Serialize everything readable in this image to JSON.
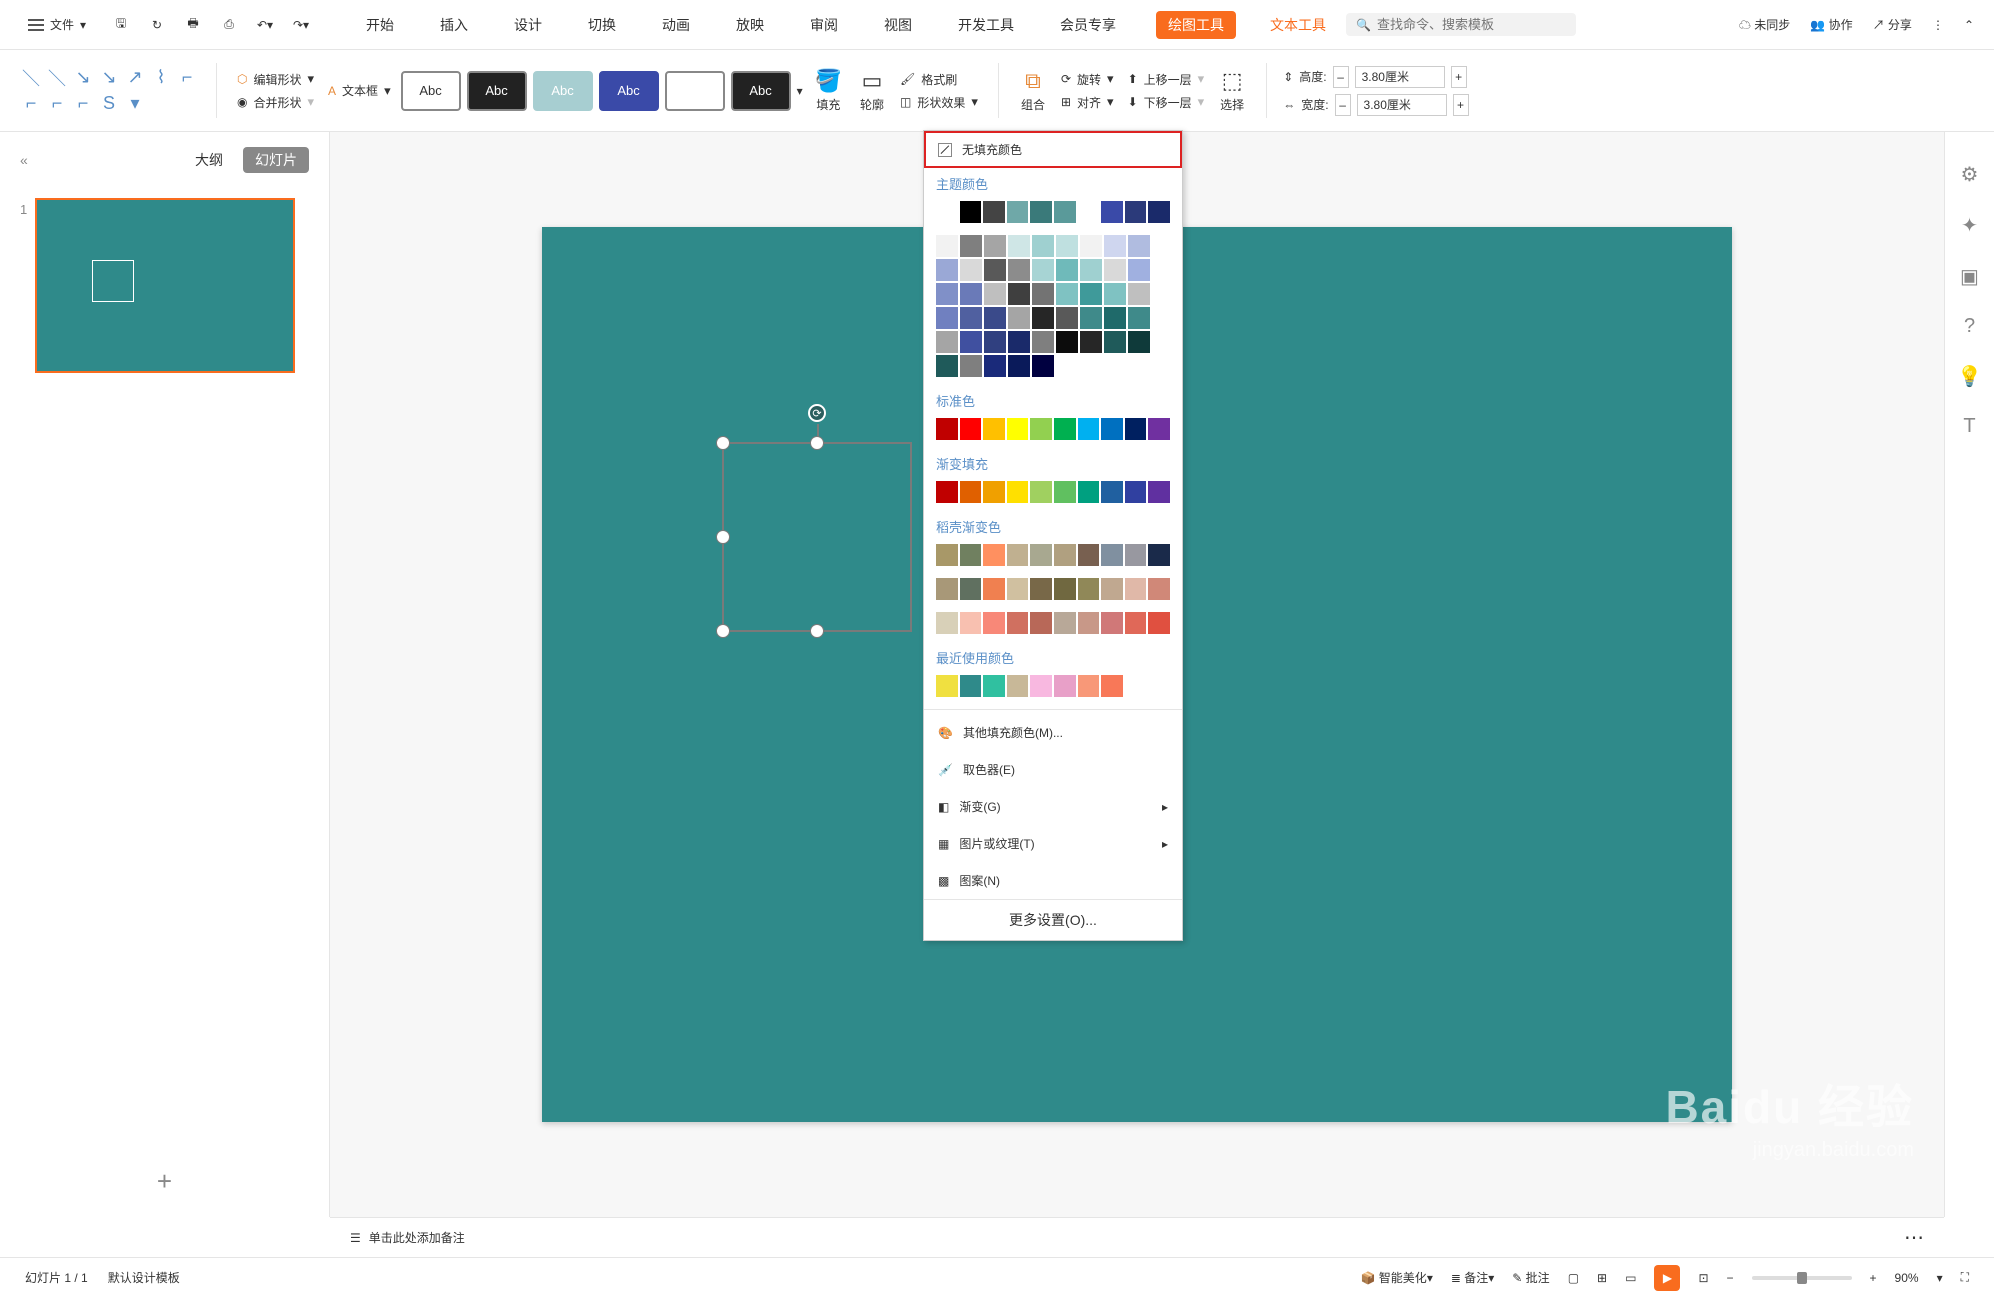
{
  "topbar": {
    "file": "文件",
    "sync": "未同步",
    "collab": "协作",
    "share": "分享"
  },
  "tabs": {
    "start": "开始",
    "insert": "插入",
    "design": "设计",
    "transition": "切换",
    "animation": "动画",
    "slideshow": "放映",
    "review": "审阅",
    "view": "视图",
    "dev": "开发工具",
    "member": "会员专享",
    "draw": "绘图工具",
    "text": "文本工具"
  },
  "search": {
    "placeholder": "查找命令、搜索模板"
  },
  "ribbon": {
    "editShape": "编辑形状",
    "mergeShape": "合并形状",
    "textbox": "文本框",
    "styleLabel": "Abc",
    "fill": "填充",
    "outline": "轮廓",
    "effects": "形状效果",
    "formatPainter": "格式刷",
    "group": "组合",
    "rotate": "旋转",
    "align": "对齐",
    "forward": "上移一层",
    "backward": "下移一层",
    "select": "选择",
    "height": "高度:",
    "width": "宽度:",
    "h_val": "3.80厘米",
    "w_val": "3.80厘米",
    "minus": "–",
    "plus": "+"
  },
  "slidepanel": {
    "outline": "大纲",
    "slides": "幻灯片",
    "num": "1"
  },
  "dropdown": {
    "noFill": "无填充颜色",
    "themeColors": "主题颜色",
    "standard": "标准色",
    "gradient": "渐变填充",
    "dokeGradient": "稻壳渐变色",
    "recent": "最近使用颜色",
    "otherFill": "其他填充颜色(M)...",
    "eyedropper": "取色器(E)",
    "grad": "渐变(G)",
    "pictex": "图片或纹理(T)",
    "pattern": "图案(N)",
    "more": "更多设置(O)...",
    "theme_row1": [
      "#ffffff",
      "#000000",
      "#444444",
      "#6fa8a8",
      "#3a7a7a",
      "#5a9a9a",
      "#ffffff",
      "#3a4aa8",
      "#2b3a7a",
      "#1a2a6a"
    ],
    "theme_matrix": [
      [
        "#f2f2f2",
        "#7f7f7f",
        "#a5a5a5",
        "#cfe6e6",
        "#9fd0d0",
        "#bfe0e0",
        "#f2f2f2",
        "#cfd6ef",
        "#b0bce0",
        "#9aa8d6"
      ],
      [
        "#d9d9d9",
        "#595959",
        "#8c8c8c",
        "#a7d4d4",
        "#6fbaba",
        "#9fd0d0",
        "#d9d9d9",
        "#a0b0e0",
        "#8090c8",
        "#6a7ab8"
      ],
      [
        "#bfbfbf",
        "#3f3f3f",
        "#737373",
        "#7fc2c2",
        "#3f9a9a",
        "#7fc2c2",
        "#bfbfbf",
        "#7080c0",
        "#5060a0",
        "#3a4a8a"
      ],
      [
        "#a5a5a5",
        "#262626",
        "#595959",
        "#3f8a8a",
        "#1f6a6a",
        "#3f8a8a",
        "#a5a5a5",
        "#4050a0",
        "#304080",
        "#1a2a6a"
      ],
      [
        "#7f7f7f",
        "#0c0c0c",
        "#262626",
        "#1f5a5a",
        "#0f3a3a",
        "#1f5a5a",
        "#7f7f7f",
        "#1a2a7a",
        "#0a1a5a",
        "#000040"
      ]
    ],
    "standard_colors": [
      "#c00000",
      "#ff0000",
      "#ffc000",
      "#ffff00",
      "#92d050",
      "#00b050",
      "#00b0f0",
      "#0070c0",
      "#002060",
      "#7030a0"
    ],
    "gradient_colors": [
      "#c00000",
      "#e06000",
      "#f0a000",
      "#ffe000",
      "#a0d060",
      "#60c060",
      "#00a080",
      "#2060a0",
      "#3040a0",
      "#6030a0"
    ],
    "doke1": [
      "#a89868",
      "#708060",
      "#ff9060",
      "#c0b090",
      "#a8a890",
      "#b0a080",
      "#786050",
      "#8090a0",
      "#9898a0",
      "#1a2a4a"
    ],
    "doke2": [
      "#a89878",
      "#607060",
      "#f08050",
      "#d0c0a0",
      "#786848",
      "#706840",
      "#908858",
      "#c0a890",
      "#e0b8a8",
      "#d08878"
    ],
    "doke3": [
      "#d8d0b8",
      "#f8c0b0",
      "#f88878",
      "#d07060",
      "#b86858",
      "#b8a898",
      "#c89888",
      "#d07878",
      "#e06858",
      "#e05040"
    ],
    "recent_colors": [
      "#f0e040",
      "#2f8a8a",
      "#30c0a0",
      "#c8b898",
      "#f8b8e0",
      "#e8a0c8",
      "#f89878",
      "#f87858",
      "#ffffff",
      "#ffffff"
    ]
  },
  "notes": {
    "text": "单击此处添加备注"
  },
  "status": {
    "slideIndex": "幻灯片 1 / 1",
    "template": "默认设计模板",
    "beautify": "智能美化",
    "notes": "备注",
    "comments": "批注",
    "zoom": "90%"
  },
  "watermark": {
    "main": "Baidu 经验",
    "sub": "jingyan.baidu.com"
  }
}
